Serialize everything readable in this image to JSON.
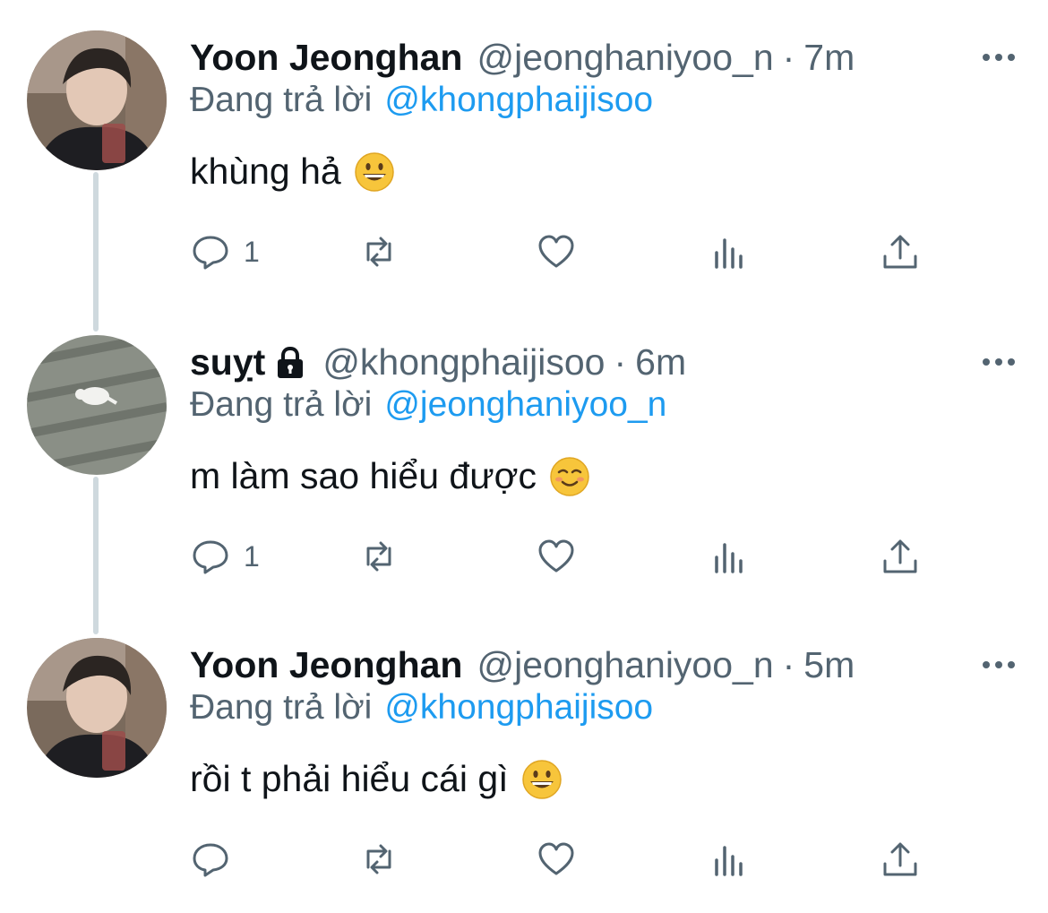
{
  "colors": {
    "link": "#1d9bf0",
    "muted": "#536471",
    "text": "#0f1419",
    "thread": "#cfd9de"
  },
  "tweets": [
    {
      "name": "Yoon Jeonghan",
      "handle": "@jeonghaniyoo_n",
      "separator": "·",
      "time": "7m",
      "protected": false,
      "reply_prefix": "Đang trả lời",
      "reply_to": "@khongphaijisoo",
      "text": "khùng hả",
      "emoji": "grinning-face-emoji",
      "reply_count": "1",
      "icons": [
        "reply-icon",
        "retweet-icon",
        "like-icon",
        "analytics-icon",
        "share-icon"
      ]
    },
    {
      "name": "suỵt",
      "handle": "@khongphaijisoo",
      "separator": "·",
      "time": "6m",
      "protected": true,
      "reply_prefix": "Đang trả lời",
      "reply_to": "@jeonghaniyoo_n",
      "text": "m làm sao hiểu được",
      "emoji": "smiling-face-emoji",
      "reply_count": "1",
      "icons": [
        "reply-icon",
        "retweet-icon",
        "like-icon",
        "analytics-icon",
        "share-icon"
      ]
    },
    {
      "name": "Yoon Jeonghan",
      "handle": "@jeonghaniyoo_n",
      "separator": "·",
      "time": "5m",
      "protected": false,
      "reply_prefix": "Đang trả lời",
      "reply_to": "@khongphaijisoo",
      "text": "rồi t phải hiểu cái gì",
      "emoji": "grinning-face-emoji",
      "reply_count": "",
      "icons": [
        "reply-icon",
        "retweet-icon",
        "like-icon",
        "analytics-icon",
        "share-icon"
      ]
    }
  ]
}
